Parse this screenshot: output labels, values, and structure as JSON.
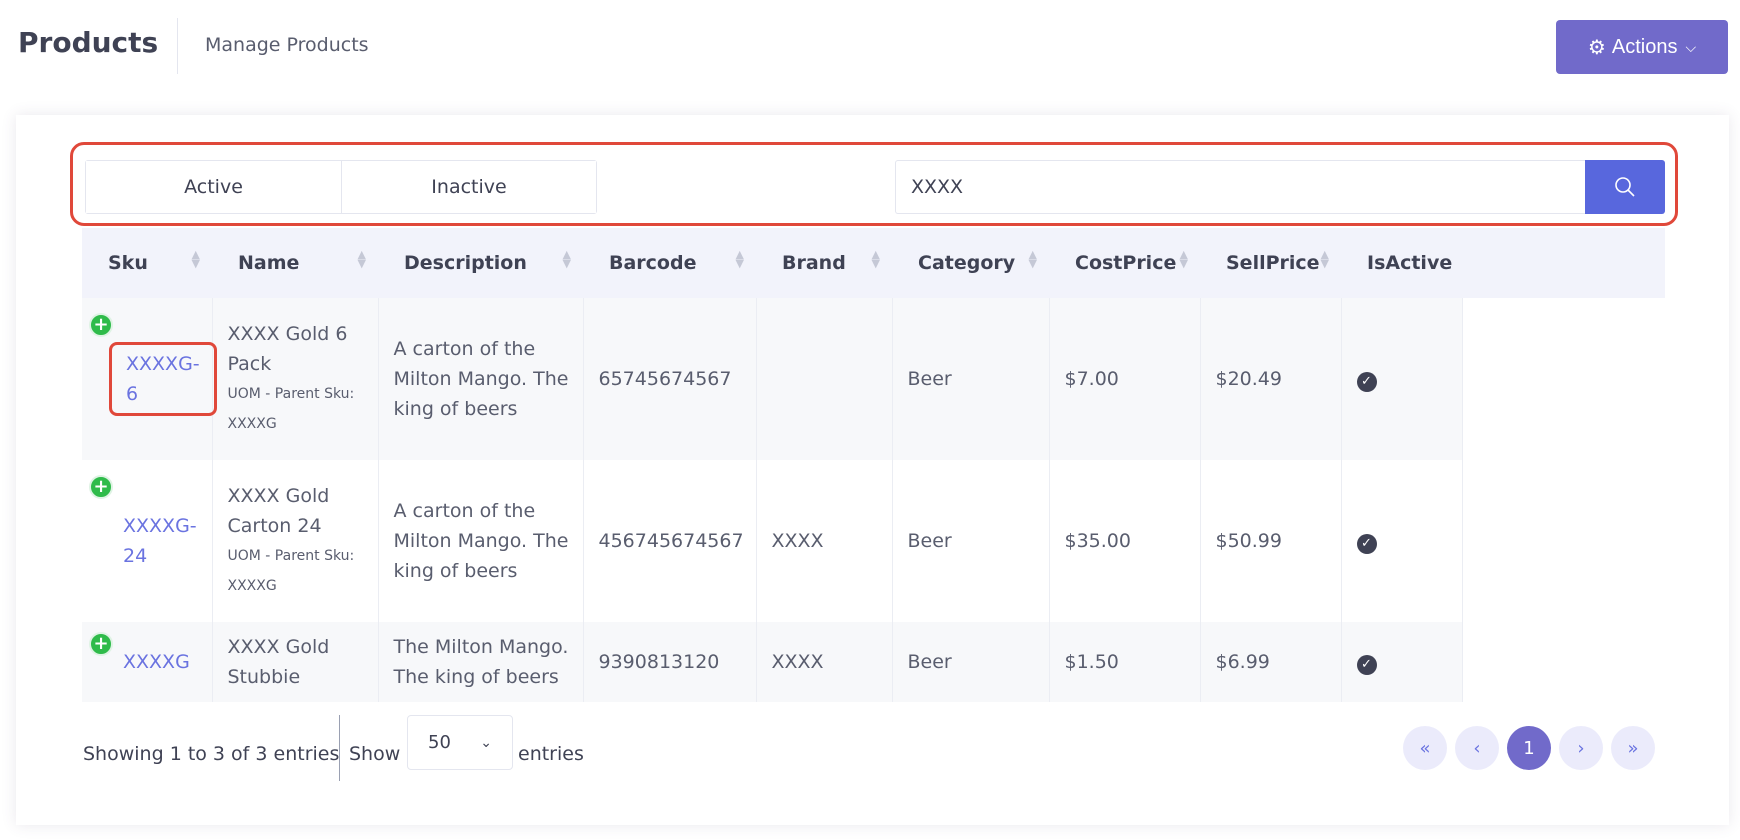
{
  "header": {
    "title": "Products",
    "subtitle": "Manage Products",
    "actions_label": "Actions"
  },
  "filters": {
    "tabs": [
      "Active",
      "Inactive"
    ],
    "search_value": "XXXX"
  },
  "table": {
    "columns": [
      "Sku",
      "Name",
      "Description",
      "Barcode",
      "Brand",
      "Category",
      "CostPrice",
      "SellPrice",
      "IsActive"
    ],
    "rows": [
      {
        "sku": "XXXXG-6",
        "name": "XXXX Gold 6 Pack",
        "note": "UOM - Parent Sku: XXXXG",
        "description": "A carton of the Milton Mango. The king of beers",
        "barcode": "65745674567",
        "brand": "",
        "category": "Beer",
        "cost": "$7.00",
        "sell": "$20.49",
        "active": true
      },
      {
        "sku": "XXXXG-24",
        "name": "XXXX Gold Carton 24",
        "note": "UOM - Parent Sku: XXXXG",
        "description": "A carton of the Milton Mango. The king of beers",
        "barcode": "456745674567",
        "brand": "XXXX",
        "category": "Beer",
        "cost": "$35.00",
        "sell": "$50.99",
        "active": true
      },
      {
        "sku": "XXXXG",
        "name": "XXXX Gold Stubbie",
        "note": "",
        "description": "The Milton Mango. The king of beers",
        "barcode": "9390813120",
        "brand": "XXXX",
        "category": "Beer",
        "cost": "$1.50",
        "sell": "$6.99",
        "active": true
      }
    ]
  },
  "footer": {
    "info": "Showing 1 to 3 of 3 entries",
    "show_label": "Show",
    "page_size": "50",
    "entries_label": "entries",
    "current_page": "1"
  },
  "colors": {
    "accent": "#716aca",
    "search_button": "#5867dd",
    "link": "#6a73e0",
    "highlight": "#e0483a",
    "add_icon": "#2fbb4a"
  }
}
